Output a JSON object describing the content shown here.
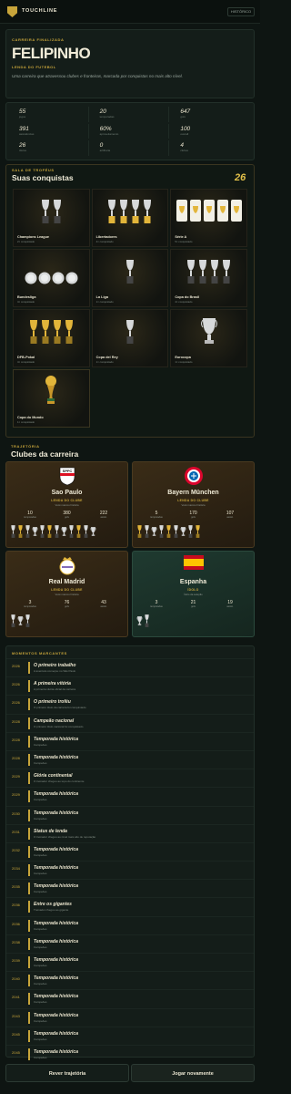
{
  "header": {
    "brand": "TOUCHLINE",
    "history_label": "HISTÓRICO"
  },
  "hero": {
    "kicker": "CARREIRA FINALIZADA",
    "name": "FELIPINHO",
    "subtitle": "LENDA DO FUTEBOL",
    "description": "Uma carreira que atravessou clubes e fronteiras, marcada por conquistas no mais alto nível."
  },
  "stats": [
    {
      "value": "55",
      "label": "jogos"
    },
    {
      "value": "20",
      "label": "temporadas"
    },
    {
      "value": "647",
      "label": "gols"
    },
    {
      "value": "391",
      "label": "assistências"
    },
    {
      "value": "60%",
      "label": "aproveitamento"
    },
    {
      "value": "100",
      "label": "overall"
    },
    {
      "value": "26",
      "label": "títulos"
    },
    {
      "value": "0",
      "label": "artilharia"
    },
    {
      "value": "4",
      "label": "clubes"
    }
  ],
  "trophies": {
    "kicker": "SALA DE TROFÉUS",
    "title": "Suas conquistas",
    "total": "26",
    "items": [
      {
        "name": "Champions League",
        "count": "2× conquistado",
        "icon": "cup-silver",
        "n": 2
      },
      {
        "name": "Libertadores",
        "count": "4× conquistado",
        "icon": "cup-silver-gold",
        "n": 4
      },
      {
        "name": "Série A",
        "count": "5× conquistado",
        "icon": "shield-gold",
        "n": 5
      },
      {
        "name": "Bundesliga",
        "count": "4× conquistado",
        "icon": "plate-silver",
        "n": 4
      },
      {
        "name": "La Liga",
        "count": "1× conquistado",
        "icon": "cup-silver",
        "n": 1
      },
      {
        "name": "Copa do Brasil",
        "count": "4× conquistado",
        "icon": "cup-silver",
        "n": 4
      },
      {
        "name": "DFB-Pokal",
        "count": "4× conquistado",
        "icon": "cup-gold",
        "n": 4
      },
      {
        "name": "Copa del Rey",
        "count": "1× conquistado",
        "icon": "cup-silver",
        "n": 1
      },
      {
        "name": "Eurocopa",
        "count": "1× conquistado",
        "icon": "cup-silver-big",
        "n": 1
      },
      {
        "name": "Copa do Mundo",
        "count": "1× conquistado",
        "icon": "world-cup",
        "n": 1
      }
    ]
  },
  "clubs": {
    "kicker": "TRAJETÓRIA",
    "title": "Clubes da carreira",
    "items": [
      {
        "name": "Sao Paulo",
        "tag": "LENDA DO CLUBE",
        "tag2": "Você marcou história",
        "stats": [
          {
            "v": "10",
            "l": "temporadas"
          },
          {
            "v": "380",
            "l": "gols"
          },
          {
            "v": "222",
            "l": "assist."
          }
        ],
        "theme": "gold",
        "badge": "spfc",
        "badge_text": "SPFC"
      },
      {
        "name": "Bayern München",
        "tag": "LENDA DO CLUBE",
        "tag2": "Você marcou história",
        "stats": [
          {
            "v": "5",
            "l": "temporadas"
          },
          {
            "v": "170",
            "l": "gols"
          },
          {
            "v": "107",
            "l": "assist."
          }
        ],
        "theme": "gold",
        "badge": "bayern",
        "badge_text": "FC BAYERN"
      },
      {
        "name": "Real Madrid",
        "tag": "LENDA DO CLUBE",
        "tag2": "Você marcou história",
        "stats": [
          {
            "v": "3",
            "l": "temporadas"
          },
          {
            "v": "76",
            "l": "gols"
          },
          {
            "v": "43",
            "l": "assist."
          }
        ],
        "theme": "gold",
        "badge": "real",
        "badge_text": ""
      },
      {
        "name": "Espanha",
        "tag": "ÍDOLO",
        "tag2": "Ídolo da seleção",
        "stats": [
          {
            "v": "3",
            "l": "temporadas"
          },
          {
            "v": "21",
            "l": "gols"
          },
          {
            "v": "19",
            "l": "assist."
          }
        ],
        "theme": "green",
        "badge": "spain-flag",
        "badge_text": ""
      }
    ]
  },
  "moments": {
    "kicker": "MOMENTOS MARCANTES",
    "items": [
      {
        "year": "2026",
        "title": "O primeiro trabalho",
        "desc": "A aventura começou no São Paulo"
      },
      {
        "year": "2026",
        "title": "A primeira vitória",
        "desc": "A primeira vitória oficial da carreira"
      },
      {
        "year": "2026",
        "title": "O primeiro troféu",
        "desc": "O primeiro título da carreira foi conquistado"
      },
      {
        "year": "2028",
        "title": "Campeão nacional",
        "desc": "O primeiro título nacional foi conquistado"
      },
      {
        "year": "2028",
        "title": "Temporada histórica",
        "desc": "Campeões"
      },
      {
        "year": "2028",
        "title": "Temporada histórica",
        "desc": "Campeões"
      },
      {
        "year": "2029",
        "title": "Glória continental",
        "desc": "O treinador chegou ao topo do continente"
      },
      {
        "year": "2029",
        "title": "Temporada histórica",
        "desc": "Campeões"
      },
      {
        "year": "2030",
        "title": "Temporada histórica",
        "desc": "Campeões"
      },
      {
        "year": "2031",
        "title": "Status de lenda",
        "desc": "O treinador chegou ao nível mais alto de reputação"
      },
      {
        "year": "2032",
        "title": "Temporada histórica",
        "desc": "Campeões"
      },
      {
        "year": "2034",
        "title": "Temporada histórica",
        "desc": "Campeões"
      },
      {
        "year": "2035",
        "title": "Temporada histórica",
        "desc": "Campeões"
      },
      {
        "year": "2036",
        "title": "Entre os gigantes",
        "desc": "Treinador chegou ao gigante"
      },
      {
        "year": "2036",
        "title": "Temporada histórica",
        "desc": "Campeões"
      },
      {
        "year": "2038",
        "title": "Temporada histórica",
        "desc": "Campeões"
      },
      {
        "year": "2039",
        "title": "Temporada histórica",
        "desc": "Campeões"
      },
      {
        "year": "2040",
        "title": "Temporada histórica",
        "desc": "Campeões"
      },
      {
        "year": "2041",
        "title": "Temporada histórica",
        "desc": "Campeões"
      },
      {
        "year": "2043",
        "title": "Temporada histórica",
        "desc": "Campeões"
      },
      {
        "year": "2045",
        "title": "Temporada histórica",
        "desc": "Campeões"
      },
      {
        "year": "2045",
        "title": "Temporada histórica",
        "desc": "Campeões"
      }
    ]
  },
  "actions": {
    "review": "Rever trajetória",
    "play_again": "Jogar novamente"
  },
  "colors": {
    "accent": "#c8a53a",
    "bg": "#0e1512",
    "card": "#141d19"
  }
}
